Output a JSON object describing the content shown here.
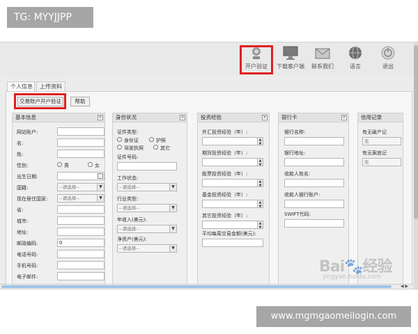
{
  "overlays": {
    "top_tag": "TG: MYYJJPP",
    "bottom_tag": "www.mgmgaomeilogin.com"
  },
  "toolbar": {
    "items": [
      {
        "label": "开户验证",
        "icon": "verify-icon"
      },
      {
        "label": "下载客户端",
        "icon": "monitor-icon"
      },
      {
        "label": "联系我们",
        "icon": "mail-icon"
      },
      {
        "label": "语言",
        "icon": "globe-icon"
      },
      {
        "label": "退出",
        "icon": "power-icon"
      }
    ],
    "highlight_color": "#e02020"
  },
  "tabs": [
    "个人信息",
    "上传资料"
  ],
  "buttons": {
    "open_account": "交易账户开户验证",
    "help": "帮助"
  },
  "sections": {
    "basic": {
      "title": "基本信息",
      "fields": {
        "account": "网站账户:",
        "first_name": "名:",
        "last_name": "姓:",
        "gender": "性别:",
        "male": "男",
        "female": "女",
        "dob": "出生日期:",
        "nationality": "国籍:",
        "nationality_placeholder": "--请选择--",
        "country": "现在居住国家:",
        "country_placeholder": "--请选择--",
        "province": "省:",
        "city": "城市:",
        "address": "地址:",
        "postcode": "邮政编码:",
        "postcode_value": "0",
        "phone": "电话号码:",
        "mobile": "手机号码:",
        "email": "电子邮件:"
      }
    },
    "identity": {
      "title": "身份状况",
      "fields": {
        "doc_type": "证件类型:",
        "id_card": "身份证",
        "passport": "护照",
        "driver": "驾驶执照",
        "other": "其它",
        "doc_no": "证件号码:",
        "work": "工作状态:",
        "work_placeholder": "--请选择--",
        "industry": "行业类型:",
        "industry_placeholder": "--请选择--",
        "income": "年收入(美元):",
        "income_placeholder": "--请选择--",
        "assets": "净资产(美元):",
        "assets_placeholder": "--请选择--"
      }
    },
    "experience": {
      "title": "投资经验",
      "fields": {
        "fx": "外汇投资经验（年）:",
        "futures": "期货投资经验（年）:",
        "stocks": "股票投资经验（年）:",
        "funds": "基金投资经验（年）:",
        "other": "其它投资经验（年）:",
        "avg": "平均每周交易金额(美元):"
      }
    },
    "bank": {
      "title": "银行卡",
      "fields": {
        "bank_name": "银行名称:",
        "bank_address": "银行地址:",
        "payee": "收款人姓名:",
        "payee_account": "收款人银行账户:",
        "swift": "SWIFT代码:"
      }
    },
    "credit": {
      "title": "信用记录",
      "fields": {
        "bad_credit": "有无破产记",
        "bad_credit_value": "无",
        "bad_record": "有无案底记",
        "bad_record_value": "无"
      }
    }
  },
  "watermark": {
    "logo": "Bai🐾经验",
    "sub": "jingyan.baidu.com"
  }
}
